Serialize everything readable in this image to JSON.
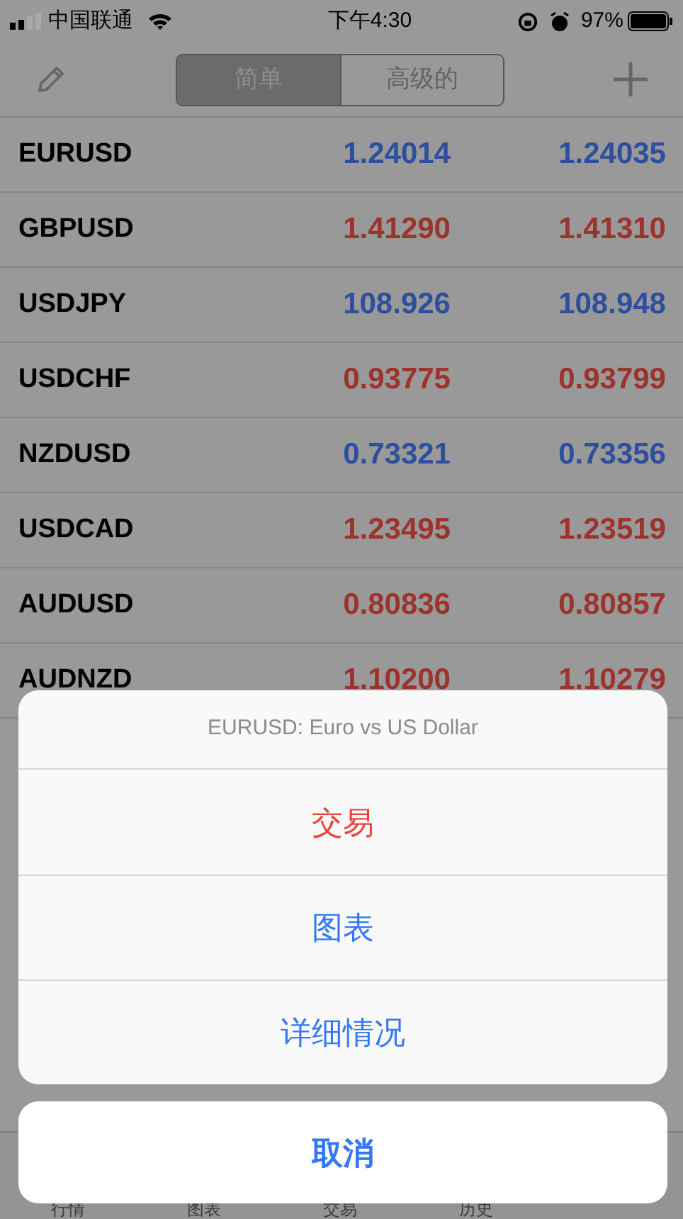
{
  "status_bar": {
    "carrier": "中国联通",
    "time": "下午4:30",
    "battery": "97%"
  },
  "nav": {
    "segments": [
      {
        "label": "简单",
        "selected": true
      },
      {
        "label": "高级的",
        "selected": false
      }
    ]
  },
  "quotes": [
    {
      "symbol": "EURUSD",
      "bid": "1.24014",
      "ask": "1.24035",
      "color": "#2d4f9e"
    },
    {
      "symbol": "GBPUSD",
      "bid": "1.41290",
      "ask": "1.41310",
      "color": "#9c332c"
    },
    {
      "symbol": "USDJPY",
      "bid": "108.926",
      "ask": "108.948",
      "color": "#2d4f9e"
    },
    {
      "symbol": "USDCHF",
      "bid": "0.93775",
      "ask": "0.93799",
      "color": "#9c332c"
    },
    {
      "symbol": "NZDUSD",
      "bid": "0.73321",
      "ask": "0.73356",
      "color": "#2d4f9e"
    },
    {
      "symbol": "USDCAD",
      "bid": "1.23495",
      "ask": "1.23519",
      "color": "#9c332c"
    },
    {
      "symbol": "AUDUSD",
      "bid": "0.80836",
      "ask": "0.80857",
      "color": "#9c332c"
    },
    {
      "symbol": "AUDNZD",
      "bid": "1.10200",
      "ask": "1.10279",
      "color": "#9c332c"
    }
  ],
  "action_sheet": {
    "title": "EURUSD: Euro vs US Dollar",
    "actions": [
      {
        "label": "交易",
        "kind": "destructive"
      },
      {
        "label": "图表",
        "kind": "default"
      },
      {
        "label": "详细情况",
        "kind": "default"
      }
    ],
    "cancel": "取消"
  },
  "tab_bar": [
    {
      "label": "行情"
    },
    {
      "label": "图表"
    },
    {
      "label": "交易"
    },
    {
      "label": "历史"
    }
  ]
}
